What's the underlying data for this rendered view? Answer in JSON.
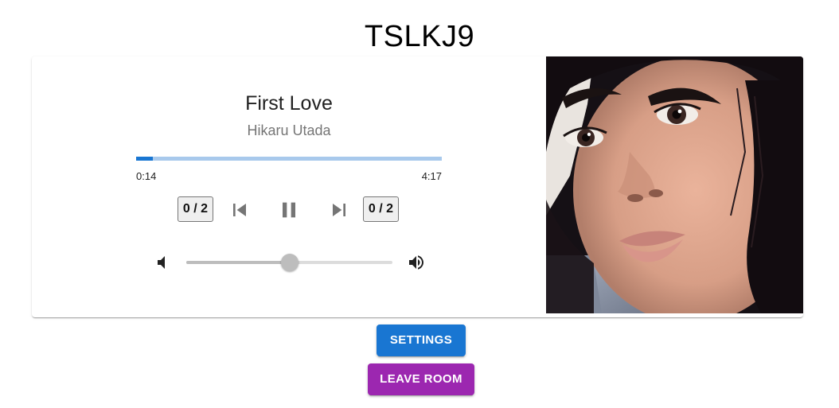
{
  "room": {
    "code": "TSLKJ9"
  },
  "player": {
    "title": "First Love",
    "artist": "Hikaru Utada",
    "progress_fraction": 0.054,
    "time_elapsed": "0:14",
    "time_total": "4:17",
    "votes_previous": "0 / 2",
    "votes_skip": "0 / 2",
    "state": "playing",
    "volume_fraction": 0.5,
    "icons": {
      "previous": "skip-previous-icon",
      "playpause": "pause-icon",
      "next": "skip-next-icon",
      "volume_down": "volume-down-icon",
      "volume_up": "volume-up-icon"
    },
    "colors": {
      "progress_fill": "#1976d2",
      "progress_track": "#a8c9ec"
    }
  },
  "actions": {
    "settings_label": "SETTINGS",
    "leave_label": "LEAVE ROOM",
    "settings_color": "#1976d2",
    "leave_color": "#9c27b0"
  }
}
